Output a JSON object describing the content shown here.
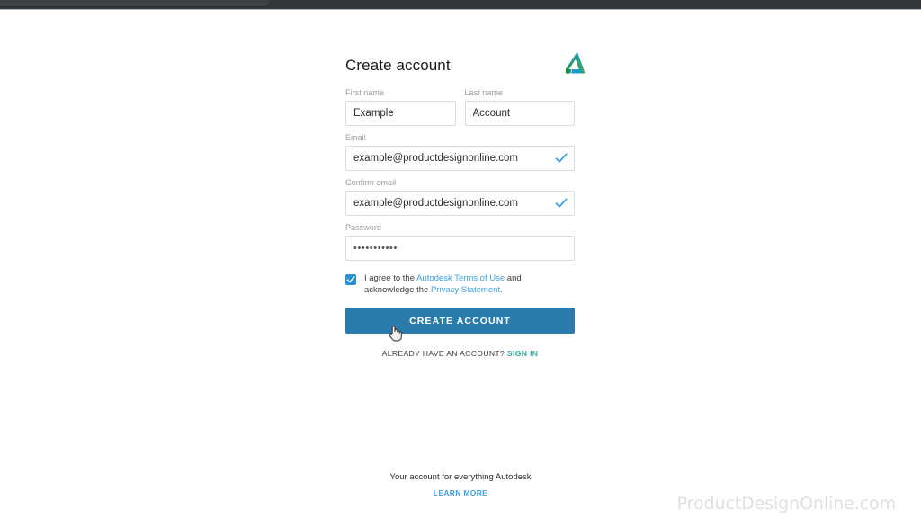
{
  "browser": {
    "chrome_bar_color": "#32373b",
    "tab_color": "#3c4145"
  },
  "brand": {
    "name": "Autodesk",
    "logo_icon": "autodesk-a-logo",
    "logo_green": "#4c9a3f",
    "logo_blue": "#0696d7"
  },
  "form": {
    "title": "Create account",
    "first_name": {
      "label": "First name",
      "value": "Example",
      "placeholder": "First name"
    },
    "last_name": {
      "label": "Last name",
      "value": "Account",
      "placeholder": "Last name"
    },
    "email": {
      "label": "Email",
      "value": "example@productdesignonline.com",
      "placeholder": "Email",
      "valid_icon": "checkmark-icon",
      "valid_color": "#2b9fe0"
    },
    "confirm_email": {
      "label": "Confirm email",
      "value": "example@productdesignonline.com",
      "placeholder": "Confirm email",
      "valid_icon": "checkmark-icon",
      "valid_color": "#2b9fe0"
    },
    "password": {
      "label": "Password",
      "value": "•••••••••••",
      "placeholder": "Password"
    },
    "consent": {
      "checked": true,
      "checkbox_color": "#2b8fd4",
      "text_before": "I agree to the ",
      "terms_link": "Autodesk Terms of Use",
      "text_middle": " and acknowledge the ",
      "privacy_link": "Privacy Statement",
      "text_after": ".",
      "link_color": "#3ea1dd"
    },
    "submit": {
      "label": "CREATE ACCOUNT",
      "color": "#2b7cad",
      "text_color": "#ffffff"
    },
    "signin": {
      "prompt": "ALREADY HAVE AN ACCOUNT?",
      "link": "SIGN IN",
      "link_color": "#3aa9a0"
    }
  },
  "cursor": {
    "icon": "pointing-hand-cursor"
  },
  "footer": {
    "tagline": "Your account for everything Autodesk",
    "learn_more": "LEARN MORE",
    "learn_more_color": "#3ea1dd"
  },
  "watermark": {
    "text": "ProductDesignOnline.com",
    "color": "#e0e0e0"
  }
}
